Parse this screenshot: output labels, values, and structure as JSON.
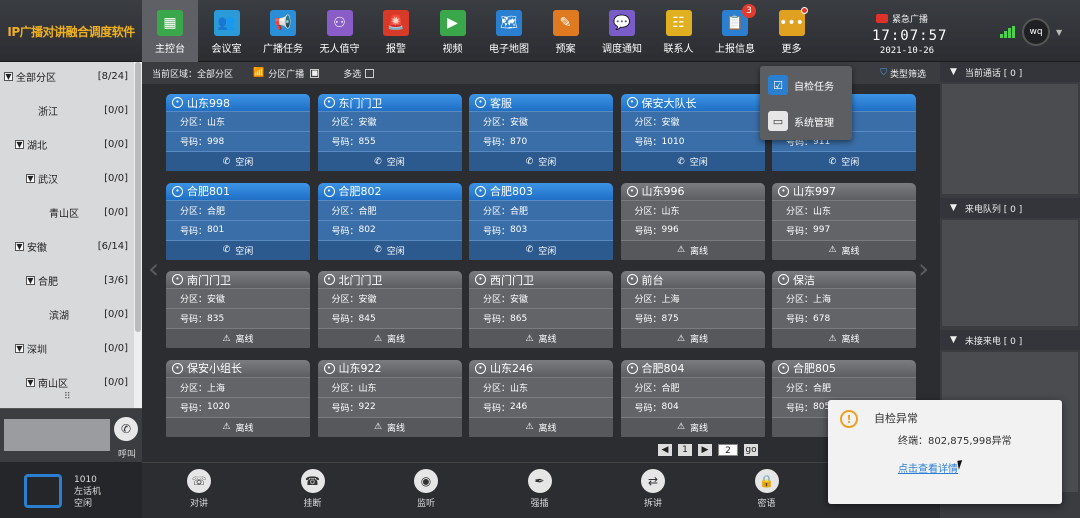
{
  "app": {
    "logo": "IP广播对讲融合调度软件"
  },
  "nav": [
    {
      "id": "main",
      "label": "主控台",
      "icon": "grid-icon",
      "color": "#3aa84a",
      "active": true
    },
    {
      "id": "meeting",
      "label": "会议室",
      "icon": "meeting-icon",
      "color": "#2a9ad8"
    },
    {
      "id": "broadcast",
      "label": "广播任务",
      "icon": "megaphone-icon",
      "color": "#2a8fd8"
    },
    {
      "id": "unattended",
      "label": "无人值守",
      "icon": "person-icon",
      "color": "#8a5cc8"
    },
    {
      "id": "alarm",
      "label": "报警",
      "icon": "alarm-icon",
      "color": "#d83a2a"
    },
    {
      "id": "video",
      "label": "视频",
      "icon": "video-icon",
      "color": "#3aa84a"
    },
    {
      "id": "map",
      "label": "电子地图",
      "icon": "map-icon",
      "color": "#2a7fd0"
    },
    {
      "id": "plan",
      "label": "预案",
      "icon": "plan-icon",
      "color": "#e07a20"
    },
    {
      "id": "dispatch",
      "label": "调度通知",
      "icon": "chat-icon",
      "color": "#7a5cc8"
    },
    {
      "id": "contacts",
      "label": "联系人",
      "icon": "contacts-icon",
      "color": "#e0b020"
    },
    {
      "id": "report",
      "label": "上报信息",
      "icon": "report-icon",
      "color": "#2a7fd0",
      "badge": "3"
    },
    {
      "id": "more",
      "label": "更多",
      "icon": "more-icon",
      "color": "#e0a020",
      "dot": true
    }
  ],
  "header": {
    "emergency": "紧急广播",
    "time": "17:07:57",
    "date": "2021-10-26",
    "user": "wq"
  },
  "tree": [
    {
      "label": "全部分区",
      "count": "[8/24]",
      "level": 0,
      "toggle": "▼"
    },
    {
      "label": "浙江",
      "count": "[0/0]",
      "level": 2
    },
    {
      "label": "湖北",
      "count": "[0/0]",
      "level": 1,
      "toggle": "▼"
    },
    {
      "label": "武汉",
      "count": "[0/0]",
      "level": 2,
      "toggle": "▼"
    },
    {
      "label": "青山区",
      "count": "[0/0]",
      "level": 3
    },
    {
      "label": "安徽",
      "count": "[6/14]",
      "level": 1,
      "toggle": "▼"
    },
    {
      "label": "合肥",
      "count": "[3/6]",
      "level": 2,
      "toggle": "▼"
    },
    {
      "label": "滨湖",
      "count": "[0/0]",
      "level": 3
    },
    {
      "label": "深圳",
      "count": "[0/0]",
      "level": 1,
      "toggle": "▼"
    },
    {
      "label": "南山区",
      "count": "[0/0]",
      "level": 2,
      "toggle": "▼"
    }
  ],
  "call": {
    "label": "呼叫"
  },
  "phone": {
    "number": "1010",
    "name": "左话机",
    "status": "空闲"
  },
  "filter": {
    "area_label": "当前区域：全部分区",
    "zone_label": "分区广播",
    "multi_label": "多选",
    "type_filter": "类型筛选"
  },
  "labels": {
    "zone": "分区：",
    "number": "号码："
  },
  "cards": [
    {
      "name": "山东998",
      "zone": "山东",
      "number": "998",
      "status": "空闲",
      "online": true
    },
    {
      "name": "东门门卫",
      "zone": "安徽",
      "number": "855",
      "status": "空闲",
      "online": true
    },
    {
      "name": "客服",
      "zone": "安徽",
      "number": "870",
      "status": "空闲",
      "online": true
    },
    {
      "name": "保安大队长",
      "zone": "安徽",
      "number": "1010",
      "status": "空闲",
      "online": true
    },
    {
      "name": "",
      "zone": "",
      "number": "911",
      "status": "空闲",
      "online": true
    },
    {
      "name": "合肥801",
      "zone": "合肥",
      "number": "801",
      "status": "空闲",
      "online": true
    },
    {
      "name": "合肥802",
      "zone": "合肥",
      "number": "802",
      "status": "空闲",
      "online": true
    },
    {
      "name": "合肥803",
      "zone": "合肥",
      "number": "803",
      "status": "空闲",
      "online": true
    },
    {
      "name": "山东996",
      "zone": "山东",
      "number": "996",
      "status": "离线",
      "online": false
    },
    {
      "name": "山东997",
      "zone": "山东",
      "number": "997",
      "status": "离线",
      "online": false
    },
    {
      "name": "南门门卫",
      "zone": "安徽",
      "number": "835",
      "status": "离线",
      "online": false
    },
    {
      "name": "北门门卫",
      "zone": "安徽",
      "number": "845",
      "status": "离线",
      "online": false
    },
    {
      "name": "西门门卫",
      "zone": "安徽",
      "number": "865",
      "status": "离线",
      "online": false
    },
    {
      "name": "前台",
      "zone": "上海",
      "number": "875",
      "status": "离线",
      "online": false
    },
    {
      "name": "保洁",
      "zone": "上海",
      "number": "678",
      "status": "离线",
      "online": false
    },
    {
      "name": "保安小组长",
      "zone": "上海",
      "number": "1020",
      "status": "离线",
      "online": false
    },
    {
      "name": "山东922",
      "zone": "山东",
      "number": "922",
      "status": "离线",
      "online": false
    },
    {
      "name": "山东246",
      "zone": "山东",
      "number": "246",
      "status": "离线",
      "online": false
    },
    {
      "name": "合肥804",
      "zone": "合肥",
      "number": "804",
      "status": "离线",
      "online": false
    },
    {
      "name": "合肥805",
      "zone": "合肥",
      "number": "805",
      "status": "离线",
      "online": false
    }
  ],
  "pager": {
    "page": "1",
    "total": "2",
    "go": "go"
  },
  "bottom": [
    {
      "label": "对讲",
      "icon": "intercom-icon"
    },
    {
      "label": "挂断",
      "icon": "hangup-icon"
    },
    {
      "label": "监听",
      "icon": "listen-icon"
    },
    {
      "label": "强插",
      "icon": "barge-icon"
    },
    {
      "label": "拆讲",
      "icon": "split-icon"
    },
    {
      "label": "密语",
      "icon": "lock-icon"
    }
  ],
  "right": {
    "current_call": "当前通话 [ 0 ]",
    "incoming_queue": "来电队列 [ 0 ]",
    "missed": "未接来电 [ 0 ]"
  },
  "dropdown": [
    {
      "label": "自检任务",
      "icon": "checklist-icon",
      "color": "#2a7fd0"
    },
    {
      "label": "系统管理",
      "icon": "monitor-icon",
      "color": "#e6e6e6"
    }
  ],
  "toast": {
    "title": "自检异常",
    "message": "终端：802,875,998异常",
    "link": "点击查看详情"
  }
}
